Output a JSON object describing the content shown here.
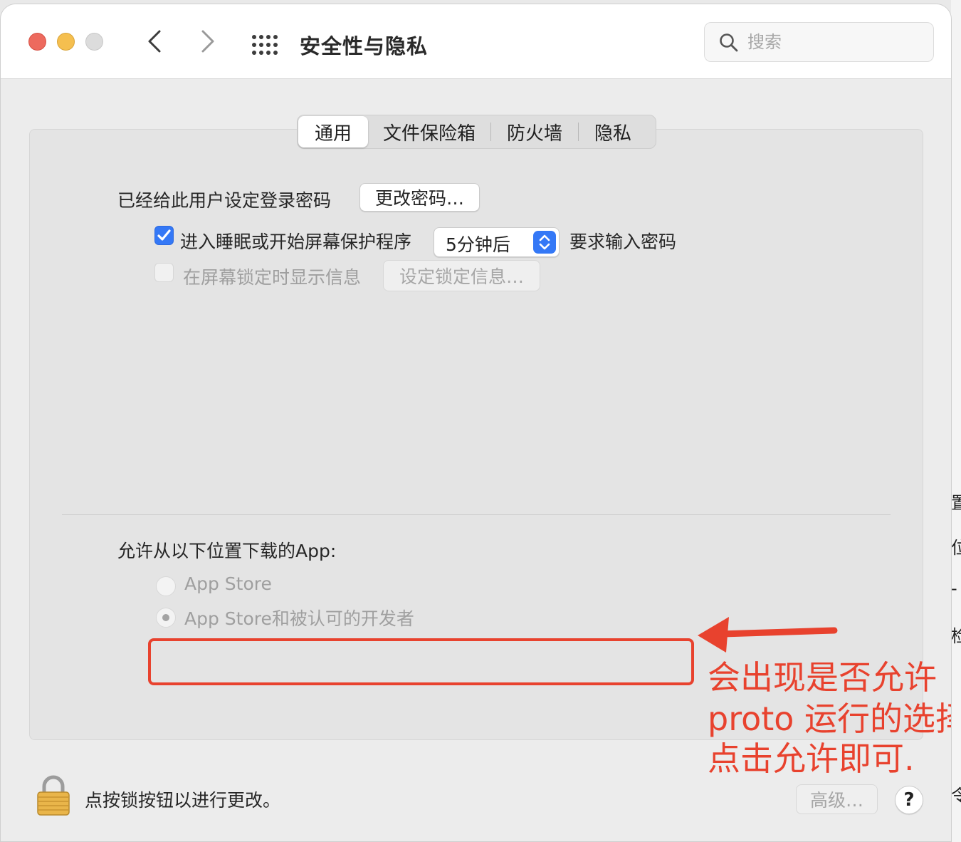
{
  "window": {
    "title": "安全性与隐私",
    "search_placeholder": "搜索"
  },
  "tabs": [
    {
      "label": "通用",
      "active": true
    },
    {
      "label": "文件保险箱",
      "active": false
    },
    {
      "label": "防火墙",
      "active": false
    },
    {
      "label": "隐私",
      "active": false
    }
  ],
  "general": {
    "login_password_label": "已经给此用户设定登录密码",
    "change_password_button": "更改密码…",
    "require_password_checked": true,
    "require_password_label": "进入睡眠或开始屏幕保护程序",
    "require_password_delay": "5分钟后",
    "require_password_suffix": "要求输入密码",
    "show_message_checked": false,
    "show_message_label": "在屏幕锁定时显示信息",
    "set_lock_message_button": "设定锁定信息…"
  },
  "downloads": {
    "heading": "允许从以下位置下载的App:",
    "options": [
      {
        "label": "App Store",
        "selected": false
      },
      {
        "label": "App Store和被认可的开发者",
        "selected": true
      }
    ]
  },
  "annotation": {
    "color": "#e8422e",
    "lines": [
      "会出现是否允许",
      "proto 运行的选择",
      "点击允许即可."
    ]
  },
  "footer": {
    "lock_text": "点按锁按钮以进行更改。",
    "advanced_button": "高级…",
    "help_button": "?"
  },
  "background": {
    "chars": [
      "置",
      "位",
      "-",
      "检",
      "令"
    ]
  },
  "colors": {
    "accent": "#3478f6",
    "close": "#ed6a5e",
    "minimize": "#f5bf4f",
    "zoom_inactive": "#dcdcdc"
  }
}
